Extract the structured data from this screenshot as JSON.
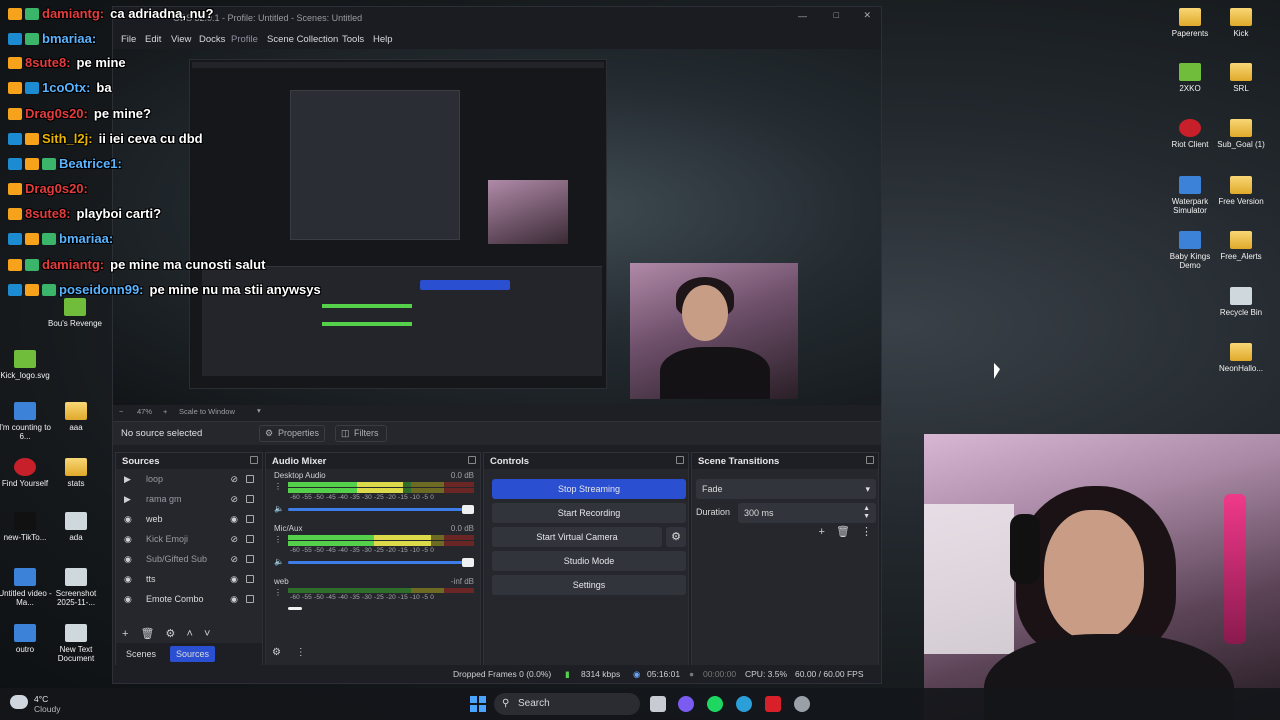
{
  "desktop": {
    "right_icons": [
      {
        "label": "Paperents",
        "kind": "folder"
      },
      {
        "label": "Kick",
        "kind": "folder"
      },
      {
        "label": "2XKO",
        "kind": "app-green"
      },
      {
        "label": "SRL",
        "kind": "folder"
      },
      {
        "label": "Riot Client",
        "kind": "app-red"
      },
      {
        "label": "Sub_Goal (1)",
        "kind": "folder"
      },
      {
        "label": "Waterpark Simulator",
        "kind": "app-blue"
      },
      {
        "label": "Free Version",
        "kind": "folder"
      },
      {
        "label": "Baby Kings Demo",
        "kind": "app-blue"
      },
      {
        "label": "Free_Alerts",
        "kind": "folder"
      },
      {
        "label": "Recycle Bin",
        "kind": "bin"
      },
      {
        "label": "NeonHallo...",
        "kind": "folder"
      }
    ],
    "left_icons": [
      {
        "label": "Bou's Revenge"
      },
      {
        "label": "Kick_logo.svg"
      },
      {
        "label": "I'm counting to 6..."
      },
      {
        "label": "aaa"
      },
      {
        "label": "Find Yourself"
      },
      {
        "label": "stats"
      },
      {
        "label": "new-TikTo..."
      },
      {
        "label": "ada"
      },
      {
        "label": "Untitled video - Ma..."
      },
      {
        "label": "Screenshot 2025-11-..."
      },
      {
        "label": "outro"
      },
      {
        "label": "New Text Document"
      }
    ]
  },
  "obs": {
    "title": "OBS 32.0.1 - Profile: Untitled - Scenes: Untitled",
    "menu": [
      "File",
      "Edit",
      "View",
      "Docks",
      "Profile",
      "Scene Collection",
      "Tools",
      "Help"
    ],
    "zoom": "47%",
    "scale_mode": "Scale to Window",
    "no_source": "No source selected",
    "properties_label": "Properties",
    "filters_label": "Filters",
    "sources_title": "Sources",
    "sources": [
      {
        "name": "loop",
        "icon": "play-icon",
        "visible": false
      },
      {
        "name": "rama gm",
        "icon": "play-icon",
        "visible": false
      },
      {
        "name": "web",
        "icon": "globe-icon",
        "visible": true
      },
      {
        "name": "Kick Emoji",
        "icon": "globe-icon",
        "visible": false
      },
      {
        "name": "Sub/Gifted Sub",
        "icon": "globe-icon",
        "visible": false
      },
      {
        "name": "tts",
        "icon": "globe-icon",
        "visible": true
      },
      {
        "name": "Emote Combo",
        "icon": "globe-icon",
        "visible": true
      }
    ],
    "tabs": {
      "scenes": "Scenes",
      "sources": "Sources"
    },
    "mixer_title": "Audio Mixer",
    "mixer": [
      {
        "name": "Desktop Audio",
        "db": "0.0 dB",
        "level": 0.62
      },
      {
        "name": "Mic/Aux",
        "db": "0.0 dB",
        "level": 0.77
      },
      {
        "name": "web",
        "db": "-inf dB",
        "level": 0.0
      }
    ],
    "meter_scale": "-60 -55 -50 -45 -40 -35 -30 -25 -20 -15 -10 -5 0",
    "controls_title": "Controls",
    "controls": {
      "stop_streaming": "Stop Streaming",
      "start_recording": "Start Recording",
      "start_virtual_camera": "Start Virtual Camera",
      "studio_mode": "Studio Mode",
      "settings": "Settings"
    },
    "transitions_title": "Scene Transitions",
    "transition": "Fade",
    "duration_label": "Duration",
    "duration_value": "300 ms",
    "status": {
      "dropped": "Dropped Frames 0 (0.0%)",
      "bitrate": "8314 kbps",
      "stream_time": "05:16:01",
      "rec_time": "00:00:00",
      "cpu": "CPU: 3.5%",
      "fps": "60.00 / 60.00 FPS"
    }
  },
  "chat": [
    {
      "user": "damiantg:",
      "msg": "ca adriadna, nu?",
      "color": "#e43c3c"
    },
    {
      "user": "bmariaa:",
      "msg": "",
      "color": "#5ab4ff"
    },
    {
      "user": "8sute8:",
      "msg": "pe mine",
      "color": "#e43c3c"
    },
    {
      "user": "1coOtx:",
      "msg": "ba",
      "color": "#5ab4ff"
    },
    {
      "user": "Drag0s20:",
      "msg": "pe mine?",
      "color": "#e43c3c"
    },
    {
      "user": "Sith_l2j:",
      "msg": "ii iei ceva cu dbd",
      "color": "#e8b400"
    },
    {
      "user": "Beatrice1:",
      "msg": "",
      "color": "#5ab4ff"
    },
    {
      "user": "Drag0s20:",
      "msg": "",
      "color": "#e43c3c"
    },
    {
      "user": "8sute8:",
      "msg": "playboi carti?",
      "color": "#e43c3c"
    },
    {
      "user": "bmariaa:",
      "msg": "",
      "color": "#5ab4ff"
    },
    {
      "user": "damiantg:",
      "msg": "pe mine ma cunosti salut",
      "color": "#e43c3c"
    },
    {
      "user": "poseidonn99:",
      "msg": "pe mine nu ma stii anywsys",
      "color": "#5ab4ff"
    }
  ],
  "taskbar": {
    "weather_temp": "4°C",
    "weather_desc": "Cloudy",
    "search": "Search"
  }
}
